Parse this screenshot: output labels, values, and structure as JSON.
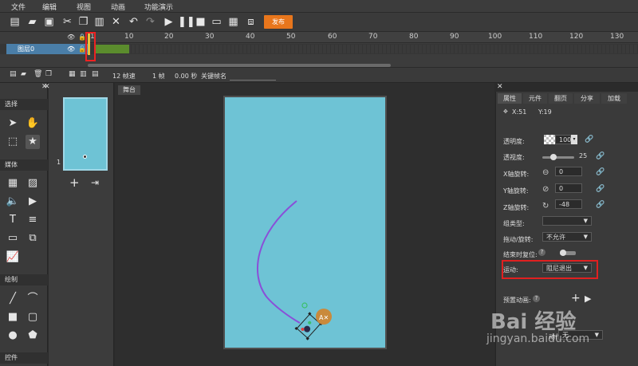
{
  "menu": [
    "文件",
    "编辑",
    "视图",
    "动画",
    "功能演示"
  ],
  "toolbar": {
    "publish_label": "发布"
  },
  "timeline": {
    "ruler_labels": [
      "1",
      "10",
      "20",
      "30",
      "40",
      "50",
      "60",
      "70",
      "80",
      "90",
      "100",
      "110",
      "120",
      "130"
    ],
    "layer_name": "图层0"
  },
  "frame_controls": {
    "fps": "12 帧速",
    "frame": "1 帧",
    "time": "0.00 秒",
    "keyframe_label": "关键帧名"
  },
  "tools": {
    "sections": [
      "选择",
      "媒体",
      "绘制",
      "控件"
    ]
  },
  "pages": {
    "page_number": "1"
  },
  "stage": {
    "tab_label": "舞台"
  },
  "props": {
    "tabs": [
      "属性",
      "元件",
      "翻页",
      "分享",
      "加载"
    ],
    "x_label": "X:51",
    "y_label": "Y:19",
    "opacity_label": "透明度:",
    "opacity_value": "100",
    "perspective_label": "透视度:",
    "perspective_value": "25",
    "xrot_label": "X轴旋转:",
    "xrot_value": "0",
    "yrot_label": "Y轴旋转:",
    "yrot_value": "0",
    "zrot_label": "Z轴旋转:",
    "zrot_value": "-48",
    "group_type_label": "组类型:",
    "group_type_value": "",
    "drag_rotate_label": "拖动/旋转:",
    "drag_rotate_value": "不允许",
    "end_reset_label": "结束时复位:",
    "motion_label": "运动:",
    "motion_value": "阻尼退出",
    "preset_label": "预置动画:",
    "action_label": "动作:",
    "action_value": "无"
  },
  "watermark": {
    "logo": "Bai 经验",
    "url": "jingyan.baidu.com"
  },
  "colors": {
    "accent": "#e8761c",
    "canvas": "#6ec3d5",
    "highlight": "#e02020",
    "path": "#8a4fd8"
  }
}
